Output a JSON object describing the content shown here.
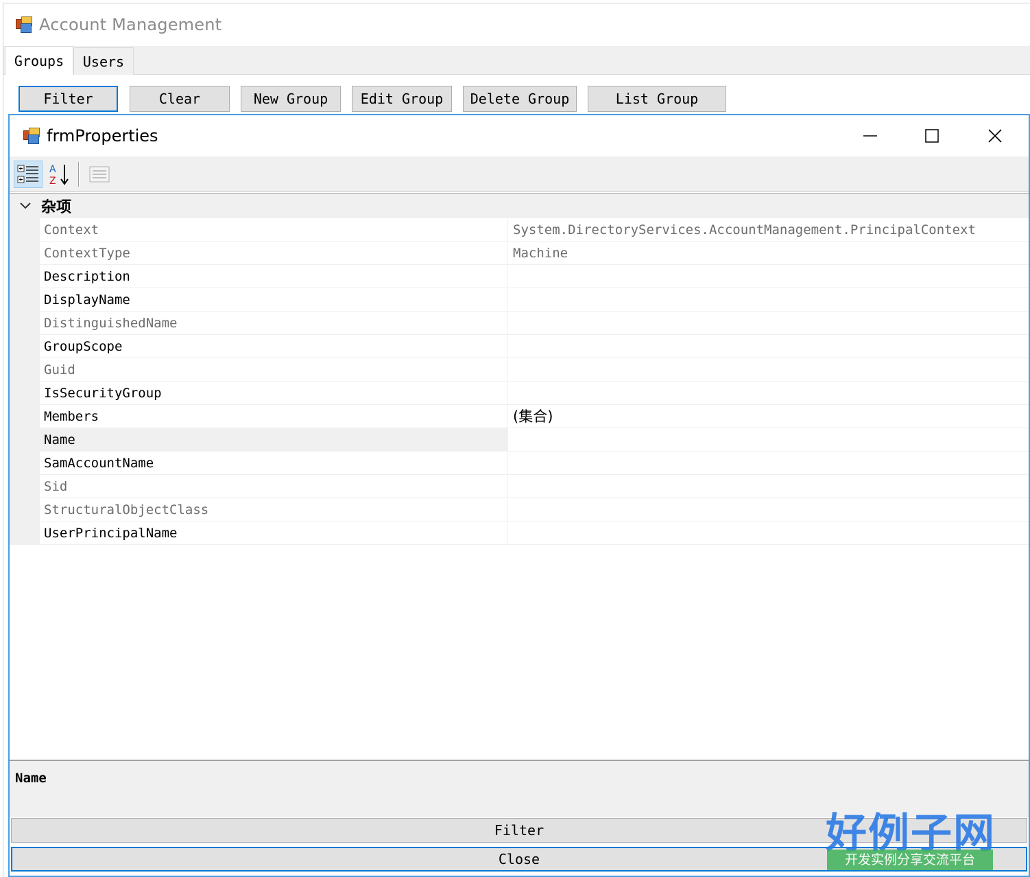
{
  "main_window": {
    "title": "Account Management",
    "tabs": [
      {
        "label": "Groups",
        "active": true
      },
      {
        "label": "Users",
        "active": false
      }
    ],
    "buttons": [
      {
        "label": "Filter"
      },
      {
        "label": "Clear"
      },
      {
        "label": "New Group"
      },
      {
        "label": "Edit Group"
      },
      {
        "label": "Delete Group"
      },
      {
        "label": "List Group"
      }
    ]
  },
  "dialog": {
    "title": "frmProperties",
    "toolbar": {
      "categorized_icon": "categorized-icon",
      "alphabetical_icon": "alphabetical-sort-icon",
      "property_pages_icon": "property-pages-icon"
    },
    "grid": {
      "category": "杂项",
      "properties": [
        {
          "name": "Context",
          "value": "System.DirectoryServices.AccountManagement.PrincipalContext",
          "readonly": true
        },
        {
          "name": "ContextType",
          "value": "Machine",
          "readonly": true
        },
        {
          "name": "Description",
          "value": "",
          "readonly": false
        },
        {
          "name": "DisplayName",
          "value": "",
          "readonly": false
        },
        {
          "name": "DistinguishedName",
          "value": "",
          "readonly": true
        },
        {
          "name": "GroupScope",
          "value": "",
          "readonly": false
        },
        {
          "name": "Guid",
          "value": "",
          "readonly": true
        },
        {
          "name": "IsSecurityGroup",
          "value": "",
          "readonly": false
        },
        {
          "name": "Members",
          "value": "(集合)",
          "readonly": false
        },
        {
          "name": "Name",
          "value": "",
          "readonly": false,
          "selected": true
        },
        {
          "name": "SamAccountName",
          "value": "",
          "readonly": false
        },
        {
          "name": "Sid",
          "value": "",
          "readonly": true
        },
        {
          "name": "StructuralObjectClass",
          "value": "",
          "readonly": true
        },
        {
          "name": "UserPrincipalName",
          "value": "",
          "readonly": false
        }
      ]
    },
    "description": {
      "title": "Name"
    },
    "buttons": {
      "filter": "Filter",
      "close": "Close"
    }
  },
  "watermark": {
    "main": "好例子网",
    "sub": "开发实例分享交流平台"
  },
  "colors": {
    "accent": "#0078d7",
    "dialog_border": "#4a9ee4",
    "readonly_text": "#6d6d6d",
    "watermark_blue": "#2c7be5",
    "watermark_green": "#3fb35a"
  }
}
